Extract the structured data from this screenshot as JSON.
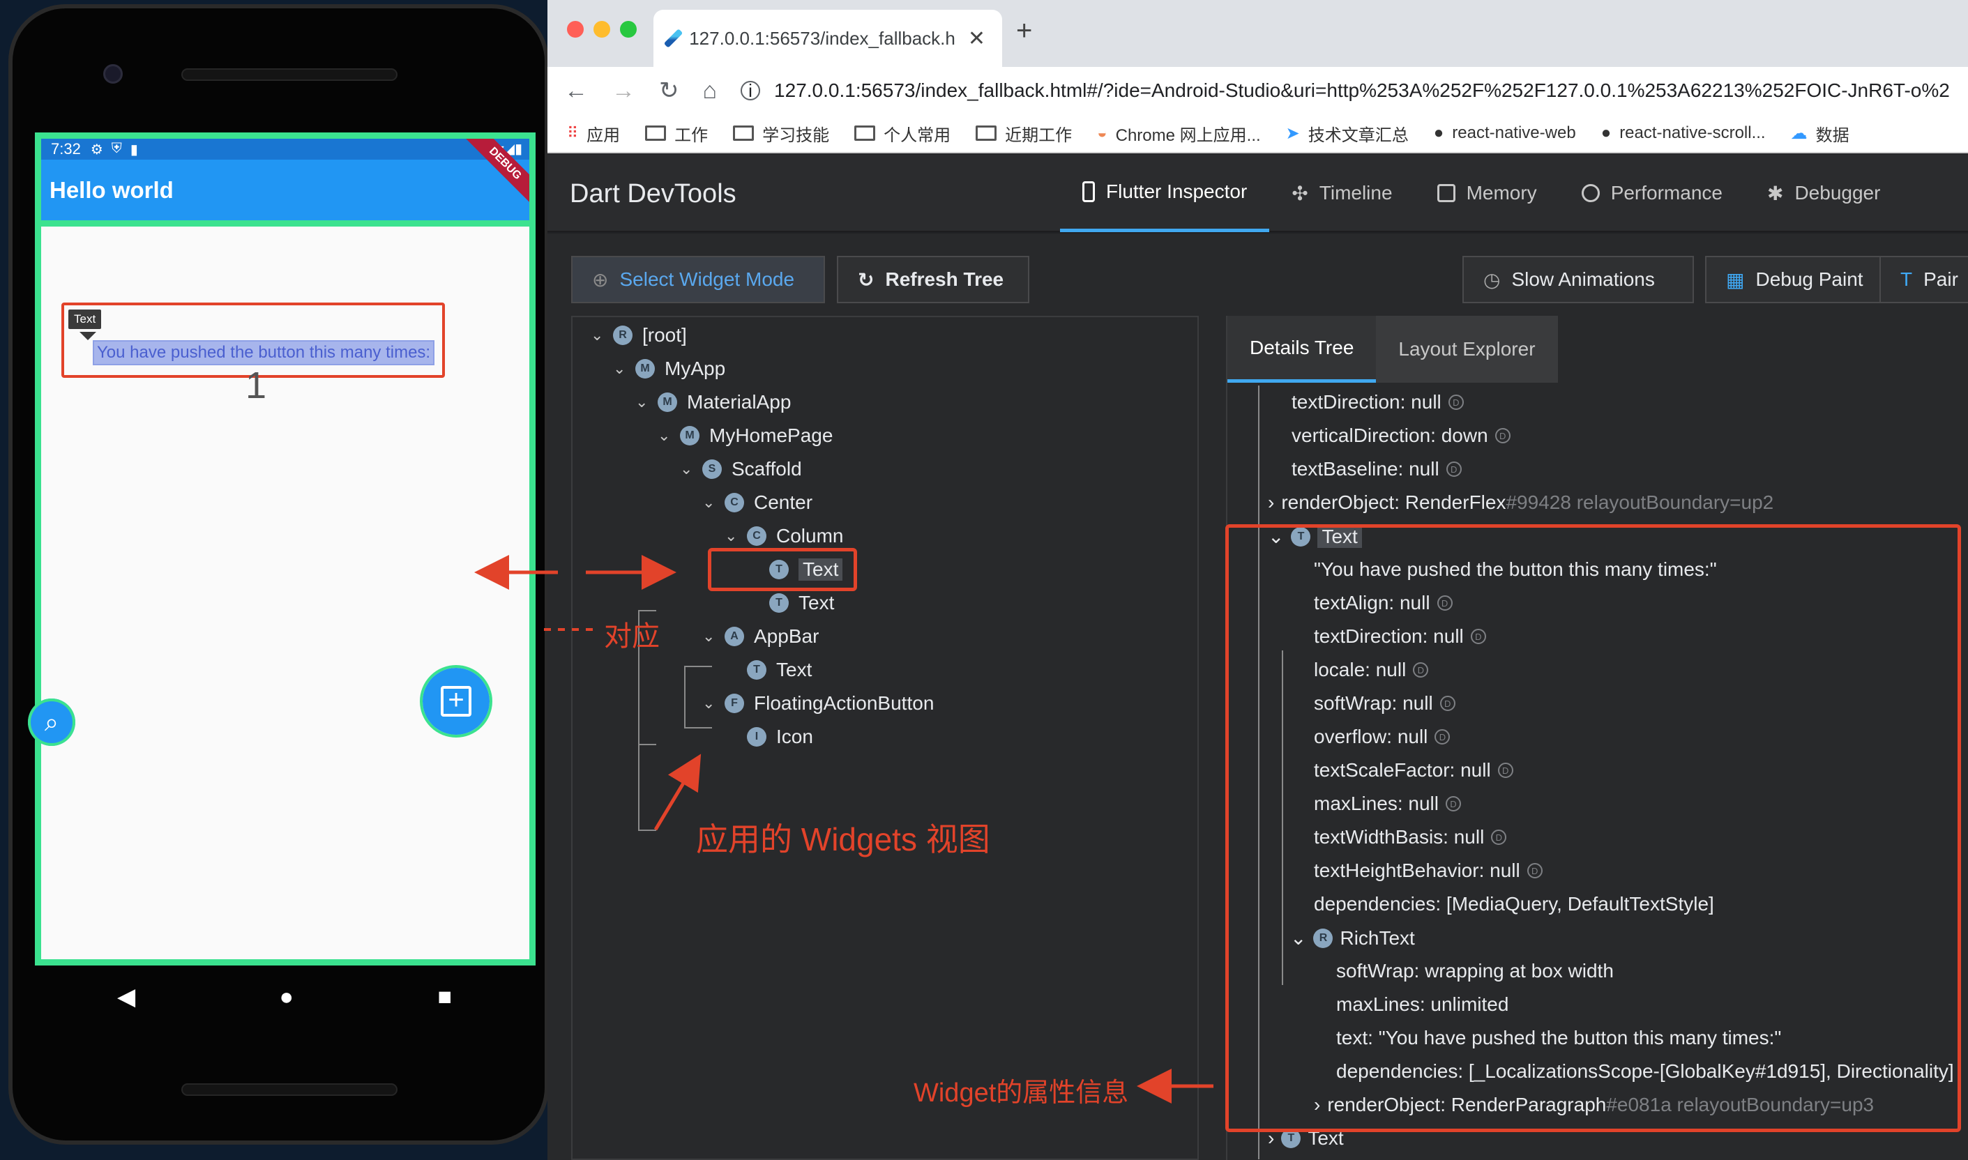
{
  "phone": {
    "time": "7:32",
    "app_title": "Hello world",
    "debug_banner": "DEBUG",
    "tooltip_label": "Text",
    "highlighted_text": "You have pushed the button this many times:",
    "counter_value": "1"
  },
  "browser": {
    "tab_title": "127.0.0.1:56573/index_fallback.h",
    "url": "127.0.0.1:56573/index_fallback.html#/?ide=Android-Studio&uri=http%253A%252F%252F127.0.0.1%253A62213%252FOIC-JnR6T-o%2",
    "bookmarks": [
      "应用",
      "工作",
      "学习技能",
      "个人常用",
      "近期工作",
      "Chrome 网上应用...",
      "技术文章汇总",
      "react-native-web",
      "react-native-scroll...",
      "数据"
    ]
  },
  "devtools": {
    "title": "Dart DevTools",
    "tabs": [
      "Flutter Inspector",
      "Timeline",
      "Memory",
      "Performance",
      "Debugger"
    ],
    "buttons": {
      "select_widget_mode": "Select Widget Mode",
      "refresh_tree": "Refresh Tree",
      "slow_animations": "Slow Animations",
      "debug_paint": "Debug Paint",
      "paint_cut": "Pair"
    },
    "tree": [
      {
        "label": "[root]",
        "badge": "R"
      },
      {
        "label": "MyApp",
        "badge": "M"
      },
      {
        "label": "MaterialApp",
        "badge": "M"
      },
      {
        "label": "MyHomePage",
        "badge": "M"
      },
      {
        "label": "Scaffold",
        "badge": "S"
      },
      {
        "label": "Center",
        "badge": "C"
      },
      {
        "label": "Column",
        "badge": "C"
      },
      {
        "label": "Text",
        "badge": "T"
      },
      {
        "label": "Text",
        "badge": "T"
      },
      {
        "label": "AppBar",
        "badge": "A"
      },
      {
        "label": "Text",
        "badge": "T"
      },
      {
        "label": "FloatingActionButton",
        "badge": "F"
      },
      {
        "label": "Icon",
        "badge": "I"
      }
    ],
    "details_tabs": [
      "Details Tree",
      "Layout Explorer"
    ],
    "props": [
      "textDirection: null",
      "verticalDirection: down",
      "textBaseline: null",
      "renderObject: RenderFlex",
      "#99428 relayoutBoundary=up2",
      "Text",
      "\"You have pushed the button this many times:\"",
      "textAlign: null",
      "textDirection: null",
      "locale: null",
      "softWrap: null",
      "overflow: null",
      "textScaleFactor: null",
      "maxLines: null",
      "textWidthBasis: null",
      "textHeightBehavior: null",
      "dependencies: [MediaQuery, DefaultTextStyle]",
      "RichText",
      "softWrap: wrapping at box width",
      "maxLines: unlimited",
      "text: \"You have pushed the button this many times:\"",
      "dependencies: [_LocalizationsScope-[GlobalKey#1d915], Directionality]",
      "renderObject: RenderParagraph",
      "#e081a relayoutBoundary=up3",
      "Text"
    ]
  },
  "annotations": {
    "correspond": "对应",
    "widgets_view": "应用的 Widgets 视图",
    "widget_props": "Widget的属性信息"
  }
}
